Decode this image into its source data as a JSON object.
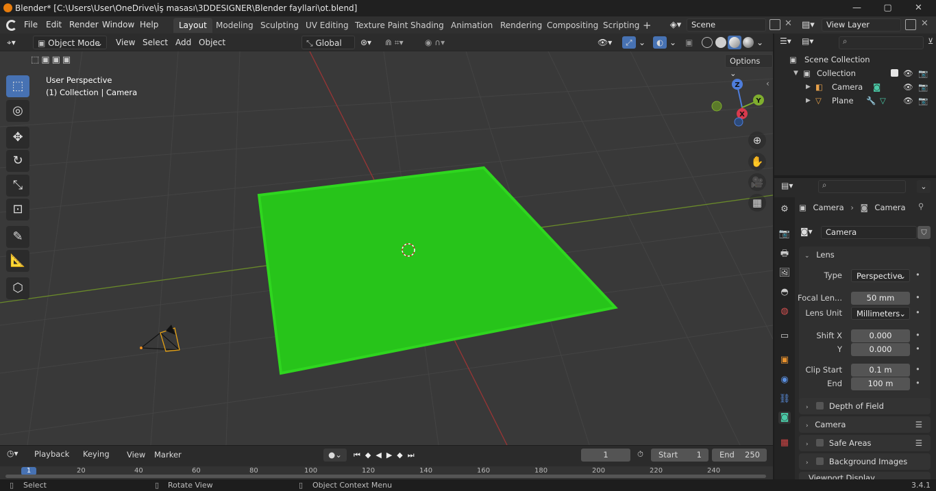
{
  "window": {
    "title": "Blender* [C:\\Users\\User\\OneDrive\\İş masası\\3DDESIGNER\\Blender fayllari\\ot.blend]",
    "minimize": "—",
    "maximize": "▢",
    "close": "✕"
  },
  "menu": {
    "items": [
      "File",
      "Edit",
      "Render",
      "Window",
      "Help"
    ],
    "workspaces": [
      "Layout",
      "Modeling",
      "Sculpting",
      "UV Editing",
      "Texture Paint",
      "Shading",
      "Animation",
      "Rendering",
      "Compositing",
      "Scripting"
    ],
    "add_workspace": "+",
    "scene": "Scene",
    "view_layer": "View Layer"
  },
  "viewport_header": {
    "mode": "Object Mode",
    "menus": [
      "View",
      "Select",
      "Add",
      "Object"
    ],
    "orientation": "Global",
    "options": "Options"
  },
  "viewport": {
    "perspective": "User Perspective",
    "context": "(1) Collection | Camera",
    "grass_color": "#27c41a",
    "gizmo": {
      "x": "X",
      "y": "Y",
      "z": "Z"
    }
  },
  "outliner": {
    "scene_collection": "Scene Collection",
    "collection": "Collection",
    "objects": [
      "Camera",
      "Plane"
    ]
  },
  "properties": {
    "breadcrumb_object": "Camera",
    "breadcrumb_data": "Camera",
    "data_name": "Camera",
    "lens_panel": "Lens",
    "type_label": "Type",
    "type_value": "Perspective",
    "focal_label": "Focal Len...",
    "focal_value": "50 mm",
    "lens_unit_label": "Lens Unit",
    "lens_unit_value": "Millimeters",
    "shift_x_label": "Shift X",
    "shift_x_value": "0.000",
    "shift_y_label": "Y",
    "shift_y_value": "0.000",
    "clip_start_label": "Clip Start",
    "clip_start_value": "0.1 m",
    "clip_end_label": "End",
    "clip_end_value": "100 m",
    "subpanels": [
      "Depth of Field",
      "Camera",
      "Safe Areas",
      "Background Images",
      "Viewport Display"
    ]
  },
  "timeline": {
    "menus": [
      "Playback",
      "Keying",
      "View",
      "Marker"
    ],
    "current_frame": "1",
    "start_label": "Start",
    "start_value": "1",
    "end_label": "End",
    "end_value": "250",
    "ruler": [
      "1",
      "20",
      "40",
      "60",
      "80",
      "100",
      "120",
      "140",
      "160",
      "180",
      "200",
      "220",
      "240"
    ]
  },
  "statusbar": {
    "select": "Select",
    "rotate": "Rotate View",
    "context_menu": "Object Context Menu",
    "version": "3.4.1"
  }
}
